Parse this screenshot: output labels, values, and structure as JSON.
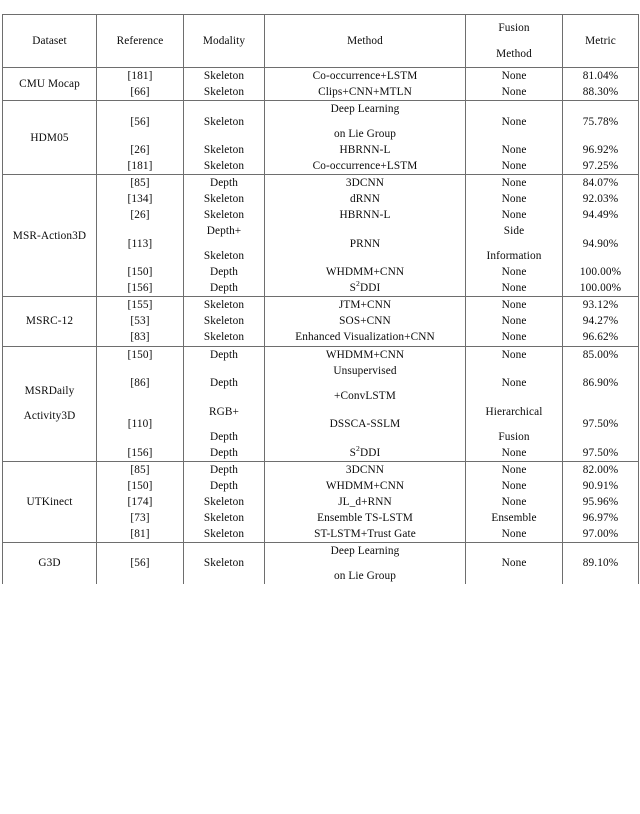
{
  "table": {
    "columns": [
      {
        "key": "dataset",
        "label": "Dataset"
      },
      {
        "key": "ref",
        "label": "Reference"
      },
      {
        "key": "modality",
        "label": "Modality"
      },
      {
        "key": "method",
        "label": "Method"
      },
      {
        "key": "fusion",
        "label": [
          "Fusion",
          "Method"
        ]
      },
      {
        "key": "metric",
        "label": "Metric"
      }
    ],
    "groups": [
      {
        "dataset": "CMU Mocap",
        "rows": [
          {
            "ref": "[181]",
            "modality": "Skeleton",
            "method": "Co-occurrence+LSTM",
            "fusion": "None",
            "metric": "81.04%"
          },
          {
            "ref": "[66]",
            "modality": "Skeleton",
            "method": "Clips+CNN+MTLN",
            "fusion": "None",
            "metric": "88.30%"
          }
        ]
      },
      {
        "dataset": "HDM05",
        "rows": [
          {
            "ref": "[56]",
            "modality": "Skeleton",
            "method": [
              "Deep Learning",
              "on Lie Group"
            ],
            "fusion": "None",
            "metric": "75.78%"
          },
          {
            "ref": "[26]",
            "modality": "Skeleton",
            "method": "HBRNN-L",
            "fusion": "None",
            "metric": "96.92%"
          },
          {
            "ref": "[181]",
            "modality": "Skeleton",
            "method": "Co-occurrence+LSTM",
            "fusion": "None",
            "metric": "97.25%"
          }
        ]
      },
      {
        "dataset": "MSR-Action3D",
        "rows": [
          {
            "ref": "[85]",
            "modality": "Depth",
            "method": "3DCNN",
            "fusion": "None",
            "metric": "84.07%"
          },
          {
            "ref": "[134]",
            "modality": "Skeleton",
            "method": "dRNN",
            "fusion": "None",
            "metric": "92.03%"
          },
          {
            "ref": "[26]",
            "modality": "Skeleton",
            "method": "HBRNN-L",
            "fusion": "None",
            "metric": "94.49%"
          },
          {
            "ref": "[113]",
            "modality": [
              "Depth+",
              "Skeleton"
            ],
            "method": "PRNN",
            "fusion": [
              "Side",
              "Information"
            ],
            "metric": "94.90%"
          },
          {
            "ref": "[150]",
            "modality": "Depth",
            "method": "WHDMM+CNN",
            "fusion": "None",
            "metric": "100.00%"
          },
          {
            "ref": "[156]",
            "modality": "Depth",
            "method": "S2DDI",
            "method_sup": "2",
            "method_pre": "S",
            "method_post": "DDI",
            "fusion": "None",
            "metric": "100.00%"
          }
        ]
      },
      {
        "dataset": "MSRC-12",
        "rows": [
          {
            "ref": "[155]",
            "modality": "Skeleton",
            "method": "JTM+CNN",
            "fusion": "None",
            "metric": "93.12%"
          },
          {
            "ref": "[53]",
            "modality": "Skeleton",
            "method": "SOS+CNN",
            "fusion": "None",
            "metric": "94.27%"
          },
          {
            "ref": "[83]",
            "modality": "Skeleton",
            "method": "Enhanced Visualization+CNN",
            "fusion": "None",
            "metric": "96.62%"
          }
        ]
      },
      {
        "dataset": [
          "MSRDaily",
          "Activity3D"
        ],
        "rows": [
          {
            "ref": "[150]",
            "modality": "Depth",
            "method": "WHDMM+CNN",
            "fusion": "None",
            "metric": "85.00%"
          },
          {
            "ref": "[86]",
            "modality": "Depth",
            "method": [
              "Unsupervised",
              "+ConvLSTM"
            ],
            "fusion": "None",
            "metric": "86.90%"
          },
          {
            "ref": "[110]",
            "modality": [
              "RGB+",
              "Depth"
            ],
            "method": "DSSCA-SSLM",
            "fusion": [
              "Hierarchical",
              "Fusion"
            ],
            "metric": "97.50%"
          },
          {
            "ref": "[156]",
            "modality": "Depth",
            "method": "S2DDI",
            "method_pre": "S",
            "method_sup": "2",
            "method_post": "DDI",
            "fusion": "None",
            "metric": "97.50%"
          }
        ]
      },
      {
        "dataset": "UTKinect",
        "rows": [
          {
            "ref": "[85]",
            "modality": "Depth",
            "method": "3DCNN",
            "fusion": "None",
            "metric": "82.00%"
          },
          {
            "ref": "[150]",
            "modality": "Depth",
            "method": "WHDMM+CNN",
            "fusion": "None",
            "metric": "90.91%"
          },
          {
            "ref": "[174]",
            "modality": "Skeleton",
            "method": "JL_d+RNN",
            "fusion": "None",
            "metric": "95.96%"
          },
          {
            "ref": "[73]",
            "modality": "Skeleton",
            "method": "Ensemble TS-LSTM",
            "fusion": "Ensemble",
            "metric": "96.97%"
          },
          {
            "ref": "[81]",
            "modality": "Skeleton",
            "method": "ST-LSTM+Trust Gate",
            "fusion": "None",
            "metric": "97.00%"
          }
        ]
      },
      {
        "dataset": "G3D",
        "rows": [
          {
            "ref": "[56]",
            "modality": "Skeleton",
            "method": [
              "Deep Learning",
              "on Lie Group"
            ],
            "fusion": "None",
            "metric": "89.10%"
          }
        ]
      }
    ]
  }
}
